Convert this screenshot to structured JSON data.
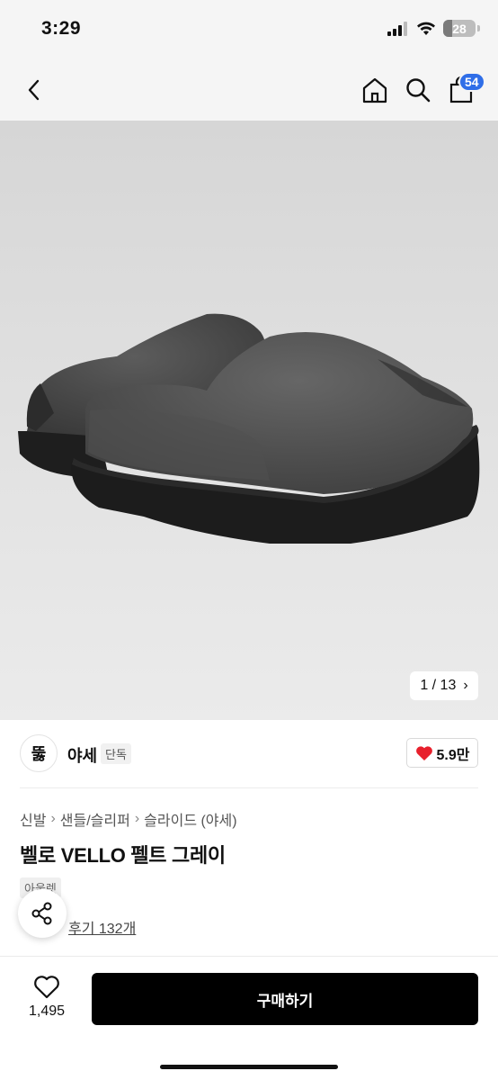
{
  "status_bar": {
    "time": "3:29",
    "battery": "28",
    "battery_level": 0.28
  },
  "nav": {
    "cart_count": "54"
  },
  "gallery": {
    "pager": "1 / 13",
    "pager_arrow": "›"
  },
  "seller": {
    "logo_text": "뚫",
    "name": "야세",
    "tag": "단독",
    "likes": "5.9만"
  },
  "breadcrumb": [
    "신발",
    "샌들/슬리퍼",
    "슬라이드 (야세)"
  ],
  "breadcrumb_sep": "›",
  "product": {
    "title": "벨로 VELLO 펠트 그레이",
    "badge": "아울렛",
    "review_text": "후기 132개"
  },
  "bottom": {
    "wish_count": "1,495",
    "buy_label": "구매하기"
  },
  "colors": {
    "accent": "#2f6ee8",
    "heart": "#e8202c",
    "button": "#000000"
  }
}
